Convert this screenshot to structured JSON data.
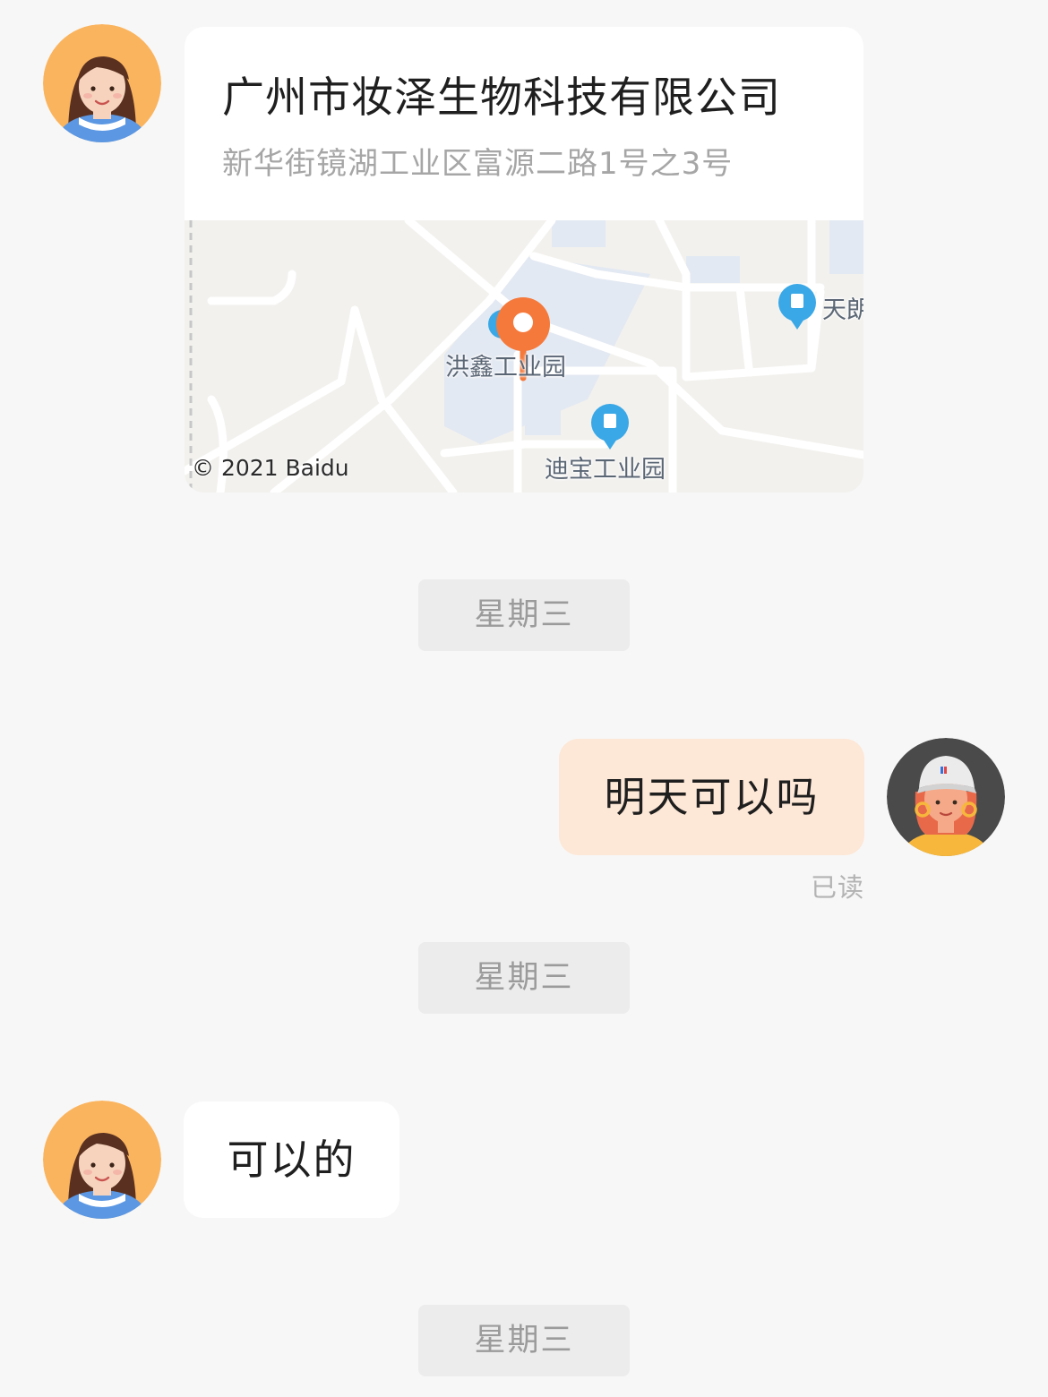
{
  "messages": {
    "location": {
      "name": "广州市妆泽生物科技有限公司",
      "address": "新华街镜湖工业区富源二路1号之3号",
      "map": {
        "labels": [
          "洪鑫工业园",
          "迪宝工业园",
          "天朗"
        ],
        "copyright": "© 2021 Baidu"
      }
    },
    "divider_1": "星期三",
    "outgoing": {
      "text": "明天可以吗",
      "status": "已读"
    },
    "divider_2": "星期三",
    "incoming": {
      "text": "可以的"
    },
    "divider_3": "星期三"
  },
  "colors": {
    "background": "#f7f7f7",
    "outgoing_bubble": "#fde7d6",
    "incoming_bubble": "#ffffff",
    "divider_chip": "#ececec",
    "map_pin": "#f5793b",
    "map_poi": "#3aa8e6"
  }
}
